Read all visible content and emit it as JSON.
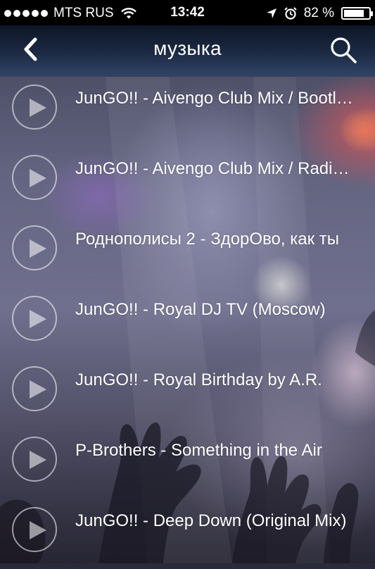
{
  "status_bar": {
    "carrier": "MTS RUS",
    "time": "13:42",
    "battery_percent_label": "82 %",
    "battery_level": 0.82,
    "icons": [
      "signal-icon",
      "wifi-icon",
      "location-icon",
      "alarm-icon",
      "battery-icon"
    ]
  },
  "nav": {
    "title": "музыка",
    "back_icon": "chevron-left-icon",
    "search_icon": "search-icon"
  },
  "tracks": [
    {
      "title": "JunGO!! - Aivengo Club Mix / Bootleg"
    },
    {
      "title": "JunGO!! - Aivengo Club Mix / Radio Edit"
    },
    {
      "title": "Роднополисы 2 - ЗдорОво, как ты"
    },
    {
      "title": "JunGO!! - Royal DJ TV (Moscow)"
    },
    {
      "title": "JunGO!! - Royal Birthday by A.R."
    },
    {
      "title": "P-Brothers - Something in the Air"
    },
    {
      "title": "JunGO!! - Deep Down (Original Mix)"
    }
  ],
  "colors": {
    "status_bar_bg": "#000000",
    "nav_bar_top": "#0d1626",
    "nav_bar_bottom": "#2f4466",
    "text": "#ffffff"
  }
}
